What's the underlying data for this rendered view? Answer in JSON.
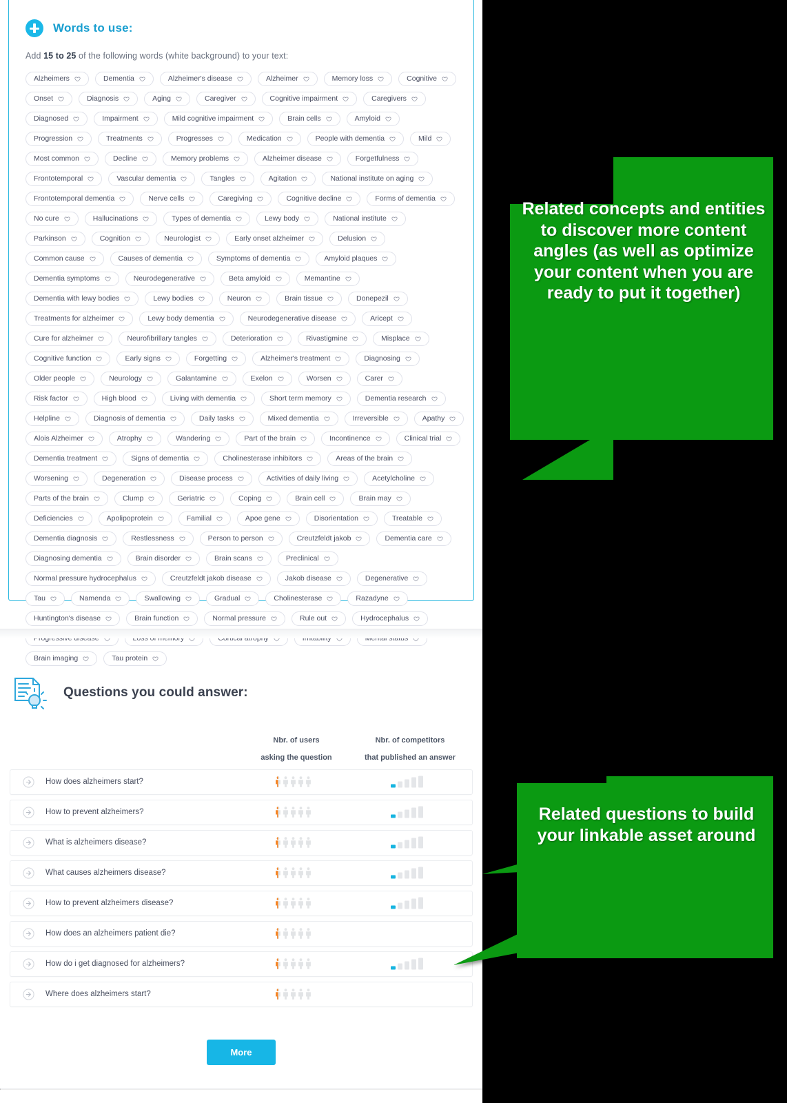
{
  "words_card": {
    "icon": "plus-circle-icon",
    "title": "Words to use:",
    "instruction_prefix": "Add ",
    "instruction_bold": "15 to 25",
    "instruction_suffix": " of the following words (white background) to your text:",
    "chip_icon": "heart-outline-icon",
    "chips": [
      "Alzheimers",
      "Dementia",
      "Alzheimer's disease",
      "Alzheimer",
      "Memory loss",
      "Cognitive",
      "Onset",
      "Diagnosis",
      "Aging",
      "Caregiver",
      "Cognitive impairment",
      "Caregivers",
      "Diagnosed",
      "Impairment",
      "Mild cognitive impairment",
      "Brain cells",
      "Amyloid",
      "Progression",
      "Treatments",
      "Progresses",
      "Medication",
      "People with dementia",
      "Mild",
      "Most common",
      "Decline",
      "Memory problems",
      "Alzheimer disease",
      "Forgetfulness",
      "Frontotemporal",
      "Vascular dementia",
      "Tangles",
      "Agitation",
      "National institute on aging",
      "Frontotemporal dementia",
      "Nerve cells",
      "Caregiving",
      "Cognitive decline",
      "Forms of dementia",
      "No cure",
      "Hallucinations",
      "Types of dementia",
      "Lewy body",
      "National institute",
      "Parkinson",
      "Cognition",
      "Neurologist",
      "Early onset alzheimer",
      "Delusion",
      "Common cause",
      "Causes of dementia",
      "Symptoms of dementia",
      "Amyloid plaques",
      "Dementia symptoms",
      "Neurodegenerative",
      "Beta amyloid",
      "Memantine",
      "Dementia with lewy bodies",
      "Lewy bodies",
      "Neuron",
      "Brain tissue",
      "Donepezil",
      "Treatments for alzheimer",
      "Lewy body dementia",
      "Neurodegenerative disease",
      "Aricept",
      "Cure for alzheimer",
      "Neurofibrillary tangles",
      "Deterioration",
      "Rivastigmine",
      "Misplace",
      "Cognitive function",
      "Early signs",
      "Forgetting",
      "Alzheimer's treatment",
      "Diagnosing",
      "Older people",
      "Neurology",
      "Galantamine",
      "Exelon",
      "Worsen",
      "Carer",
      "Risk factor",
      "High blood",
      "Living with dementia",
      "Short term memory",
      "Dementia research",
      "Helpline",
      "Diagnosis of dementia",
      "Daily tasks",
      "Mixed dementia",
      "Irreversible",
      "Apathy",
      "Alois Alzheimer",
      "Atrophy",
      "Wandering",
      "Part of the brain",
      "Incontinence",
      "Clinical trial",
      "Dementia treatment",
      "Signs of dementia",
      "Cholinesterase inhibitors",
      "Areas of the brain",
      "Worsening",
      "Degeneration",
      "Disease process",
      "Activities of daily living",
      "Acetylcholine",
      "Parts of the brain",
      "Clump",
      "Geriatric",
      "Coping",
      "Brain cell",
      "Brain may",
      "Deficiencies",
      "Apolipoprotein",
      "Familial",
      "Apoe gene",
      "Disorientation",
      "Treatable",
      "Dementia diagnosis",
      "Restlessness",
      "Person to person",
      "Creutzfeldt jakob",
      "Dementia care",
      "Diagnosing dementia",
      "Brain disorder",
      "Brain scans",
      "Preclinical",
      "Normal pressure hydrocephalus",
      "Creutzfeldt jakob disease",
      "Jakob disease",
      "Degenerative",
      "Tau",
      "Namenda",
      "Swallowing",
      "Gradual",
      "Cholinesterase",
      "Razadyne",
      "Huntington's disease",
      "Brain function",
      "Normal pressure",
      "Rule out",
      "Hydrocephalus",
      "Progressive disease",
      "Loss of memory",
      "Cortical atrophy",
      "Irritability",
      "Mental status",
      "Brain imaging",
      "Tau protein"
    ]
  },
  "questions_panel": {
    "icon": "document-lightbulb-icon",
    "title": "Questions you could answer:",
    "columns": {
      "users": {
        "line1": "Nbr. of users",
        "line2": "asking the question"
      },
      "competitors": {
        "line1": "Nbr. of competitors",
        "line2": "that published an answer"
      }
    },
    "row_icon": "arrow-right-circle-icon",
    "rows": [
      {
        "question": "How does alzheimers start?",
        "users_filled": 0.5,
        "users_total": 5,
        "competitors_filled": 1,
        "competitors_total": 5
      },
      {
        "question": "How to prevent alzheimers?",
        "users_filled": 0.5,
        "users_total": 5,
        "competitors_filled": 1,
        "competitors_total": 5
      },
      {
        "question": "What is alzheimers disease?",
        "users_filled": 0.5,
        "users_total": 5,
        "competitors_filled": 1,
        "competitors_total": 5
      },
      {
        "question": "What causes alzheimers disease?",
        "users_filled": 0.5,
        "users_total": 5,
        "competitors_filled": 1,
        "competitors_total": 5
      },
      {
        "question": "How to prevent alzheimers disease?",
        "users_filled": 0.5,
        "users_total": 5,
        "competitors_filled": 1,
        "competitors_total": 5
      },
      {
        "question": "How does an alzheimers patient die?",
        "users_filled": 0.5,
        "users_total": 5,
        "competitors_filled": 0,
        "competitors_total": 0
      },
      {
        "question": "How do i get diagnosed for alzheimers?",
        "users_filled": 0.5,
        "users_total": 5,
        "competitors_filled": 1,
        "competitors_total": 5
      },
      {
        "question": "Where does alzheimers start?",
        "users_filled": 0.5,
        "users_total": 5,
        "competitors_filled": 0,
        "competitors_total": 0
      }
    ],
    "more_label": "More"
  },
  "callouts": [
    {
      "text": "Related concepts and entities to discover more content angles (as well as optimize your content when you are ready to put it together)"
    },
    {
      "text": "Related questions to build your linkable asset around"
    }
  ],
  "colors": {
    "brand_cyan": "#1bb8e8",
    "callout_green": "#0b9a12",
    "person_orange": "#f58220",
    "person_grey": "#e2e4e6",
    "bar_cyan": "#16b4e0",
    "bar_grey": "#e4e6e9"
  }
}
